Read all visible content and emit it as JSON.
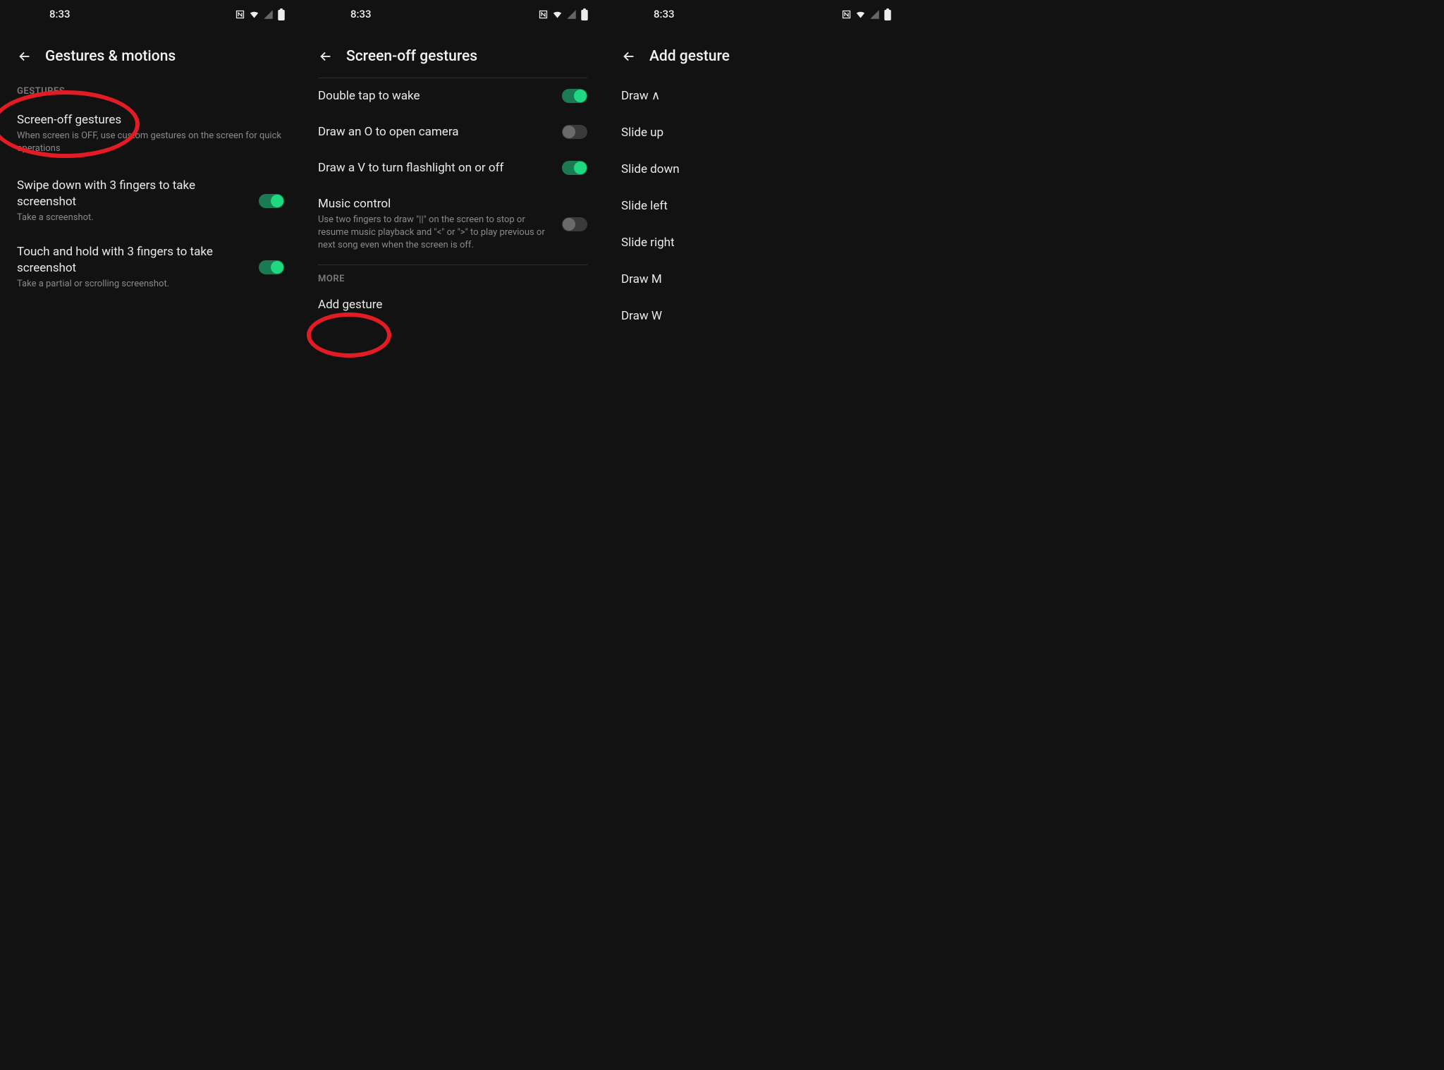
{
  "status_time": "8:33",
  "panel1": {
    "title": "Gestures & motions",
    "section": "GESTURES",
    "items": [
      {
        "title": "Screen-off gestures",
        "sub": "When screen is OFF, use custom gestures on the screen for quick operations",
        "toggle": null
      },
      {
        "title": "Swipe down with 3 fingers to take screenshot",
        "sub": "Take a screenshot.",
        "toggle": "on"
      },
      {
        "title": "Touch and hold with 3 fingers to take screenshot",
        "sub": "Take a partial or scrolling screenshot.",
        "toggle": "on"
      }
    ]
  },
  "panel2": {
    "title": "Screen-off gestures",
    "items": [
      {
        "title": "Double tap to wake",
        "sub": "",
        "toggle": "on"
      },
      {
        "title": "Draw an O to open camera",
        "sub": "",
        "toggle": "off"
      },
      {
        "title": "Draw a V to turn flashlight on or off",
        "sub": "",
        "toggle": "on"
      },
      {
        "title": "Music control",
        "sub": "Use two fingers to draw \"||\" on the screen to stop or resume music playback and \"<\" or \">\" to play previous or next song even when the screen is off.",
        "toggle": "off"
      }
    ],
    "more_label": "MORE",
    "add_gesture": "Add gesture"
  },
  "panel3": {
    "title": "Add gesture",
    "rows": [
      "Draw ∧",
      "Slide up",
      "Slide down",
      "Slide left",
      "Slide right",
      "Draw M",
      "Draw W"
    ]
  }
}
